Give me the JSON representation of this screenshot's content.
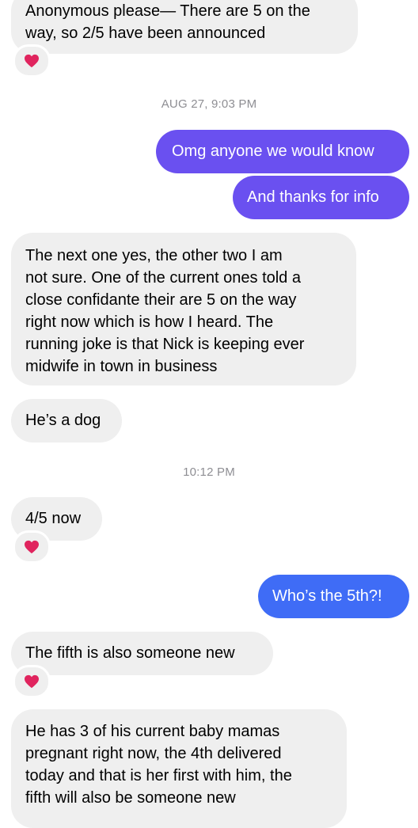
{
  "messages": [
    {
      "id": "m1",
      "direction": "received",
      "lines": [
        "Anonymous please— There are 5 on the",
        "way, so 2/5 have been announced"
      ],
      "reaction": "heart-icon"
    },
    {
      "id": "ts1",
      "type": "timestamp",
      "text": "AUG 27, 9:03 PM"
    },
    {
      "id": "m2",
      "direction": "sent",
      "lines": [
        "Omg anyone we would know"
      ]
    },
    {
      "id": "m3",
      "direction": "sent",
      "lines": [
        "And thanks for info"
      ]
    },
    {
      "id": "m4",
      "direction": "received",
      "lines": [
        "The next one yes, the other two I am",
        "not sure. One of the current ones told a",
        "close confidante their are 5 on the way",
        "right now which is how I heard. The",
        "running joke is that Nick is keeping ever",
        "midwife in town in business"
      ]
    },
    {
      "id": "m5",
      "direction": "received",
      "lines": [
        "He’s a dog"
      ]
    },
    {
      "id": "ts2",
      "type": "timestamp",
      "text": "10:12 PM"
    },
    {
      "id": "m6",
      "direction": "received",
      "lines": [
        "4/5 now"
      ],
      "reaction": "heart-icon"
    },
    {
      "id": "m7",
      "direction": "sent",
      "lines": [
        "Who’s the 5th?!"
      ]
    },
    {
      "id": "m8",
      "direction": "received",
      "lines": [
        "The fifth is also someone new"
      ],
      "reaction": "heart-icon"
    },
    {
      "id": "m9",
      "direction": "received",
      "lines": [
        "He has 3 of his current baby mamas",
        "pregnant right now, the 4th delivered",
        "today and that is her first with him, the",
        "fifth will also be someone new"
      ]
    }
  ],
  "colors": {
    "received_bubble": "#efefef",
    "sent_purple": "#6a50f0",
    "sent_blue": "#3f6cf6",
    "timestamp": "#8e8e93",
    "heart": "#e0245e"
  }
}
